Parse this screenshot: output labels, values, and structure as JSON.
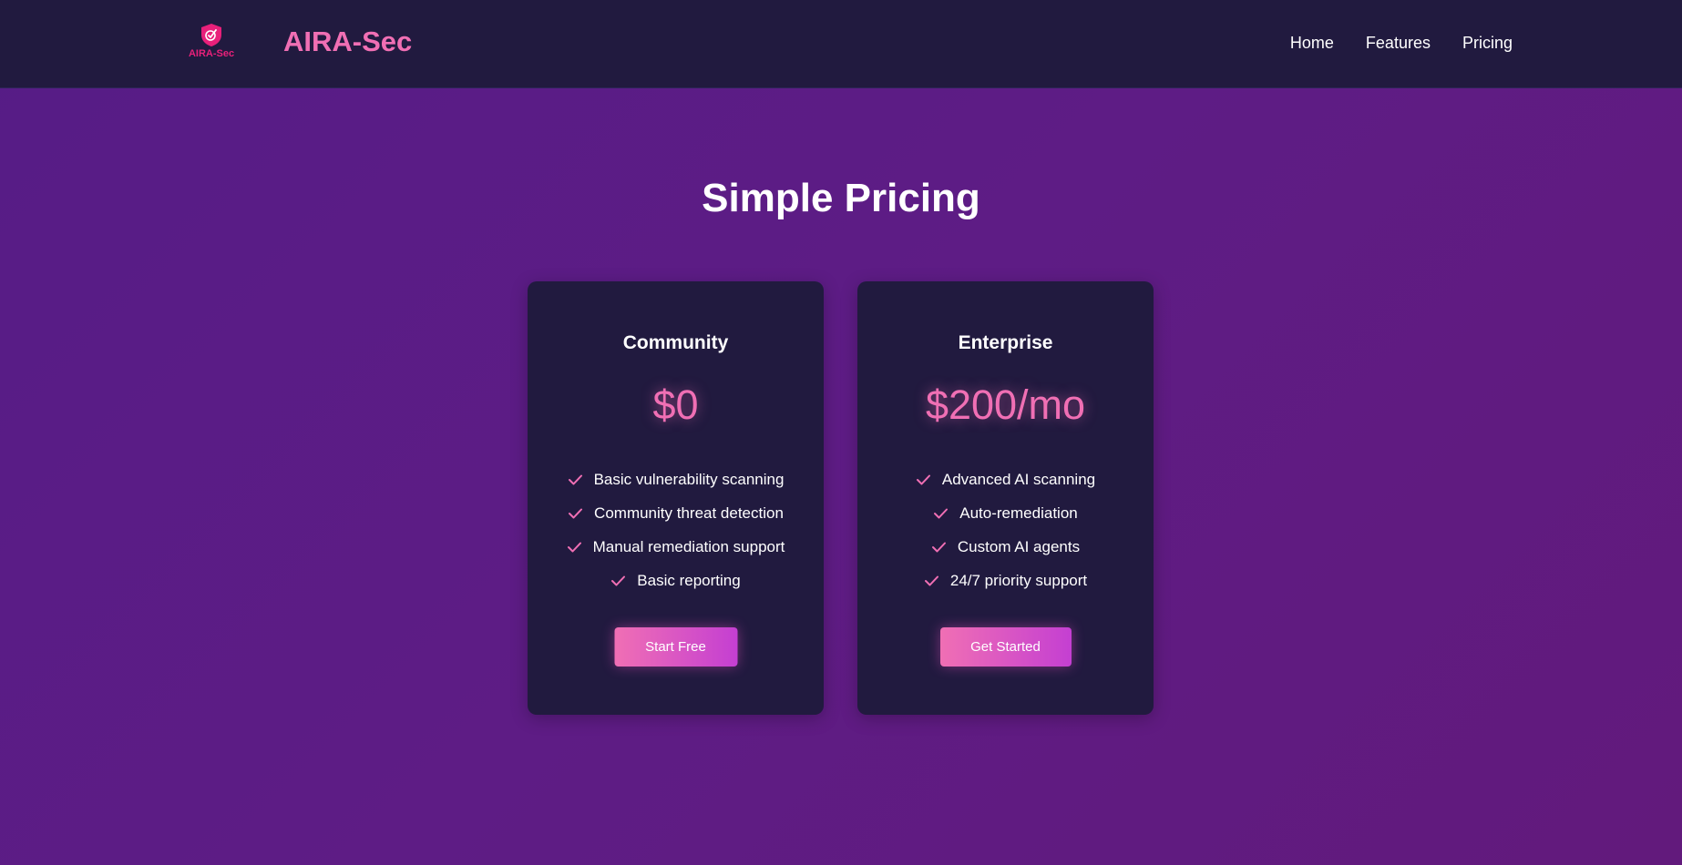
{
  "header": {
    "logo_text": "AIRA-Sec",
    "brand": "AIRA-Sec",
    "nav": [
      {
        "label": "Home"
      },
      {
        "label": "Features"
      },
      {
        "label": "Pricing"
      }
    ]
  },
  "main": {
    "title": "Simple Pricing",
    "plans": [
      {
        "name": "Community",
        "price": "$0",
        "features": [
          "Basic vulnerability scanning",
          "Community threat detection",
          "Manual remediation support",
          "Basic reporting"
        ],
        "cta": "Start Free"
      },
      {
        "name": "Enterprise",
        "price": "$200/mo",
        "features": [
          "Advanced AI scanning",
          "Auto-remediation",
          "Custom AI agents",
          "24/7 priority support"
        ],
        "cta": "Get Started"
      }
    ]
  },
  "colors": {
    "accent": "#f06fb4",
    "header_bg": "#211a3f",
    "card_bg": "#211a3f",
    "page_bg": "#5a1c86"
  },
  "icons": {
    "logo": "shield-logo-icon",
    "feature": "check-icon"
  }
}
